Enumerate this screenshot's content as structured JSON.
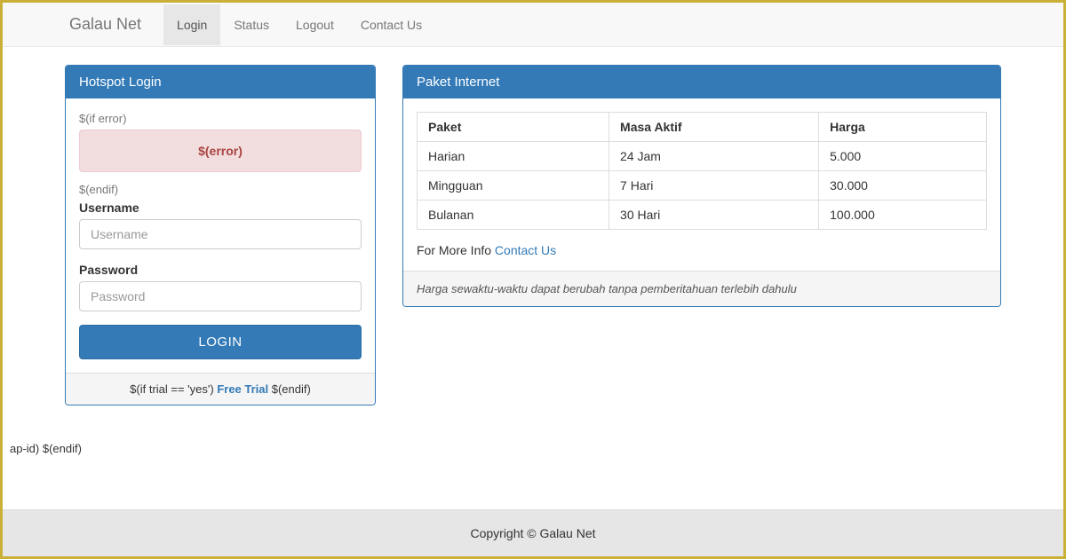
{
  "nav": {
    "brand": "Galau Net",
    "items": [
      "Login",
      "Status",
      "Logout",
      "Contact Us"
    ],
    "active_index": 0
  },
  "login_panel": {
    "title": "Hotspot Login",
    "if_error": "$(if error)",
    "error_text": "$(error)",
    "endif": "$(endif)",
    "username_label": "Username",
    "username_placeholder": "Username",
    "password_label": "Password",
    "password_placeholder": "Password",
    "login_button": "LOGIN",
    "trial_prefix": "$(if trial == 'yes') ",
    "trial_link": "Free Trial",
    "trial_suffix": " $(endif)"
  },
  "paket_panel": {
    "title": "Paket Internet",
    "headers": [
      "Paket",
      "Masa Aktif",
      "Harga"
    ],
    "rows": [
      [
        "Harian",
        "24 Jam",
        "5.000"
      ],
      [
        "Mingguan",
        "7 Hari",
        "30.000"
      ],
      [
        "Bulanan",
        "30 Hari",
        "100.000"
      ]
    ],
    "more_info_prefix": "For More Info ",
    "more_info_link": "Contact Us",
    "note": "Harga sewaktu-waktu dapat berubah tanpa pemberitahuan terlebih dahulu"
  },
  "stray_text": "ap-id) $(endif)",
  "footer": "Copyright © Galau Net"
}
